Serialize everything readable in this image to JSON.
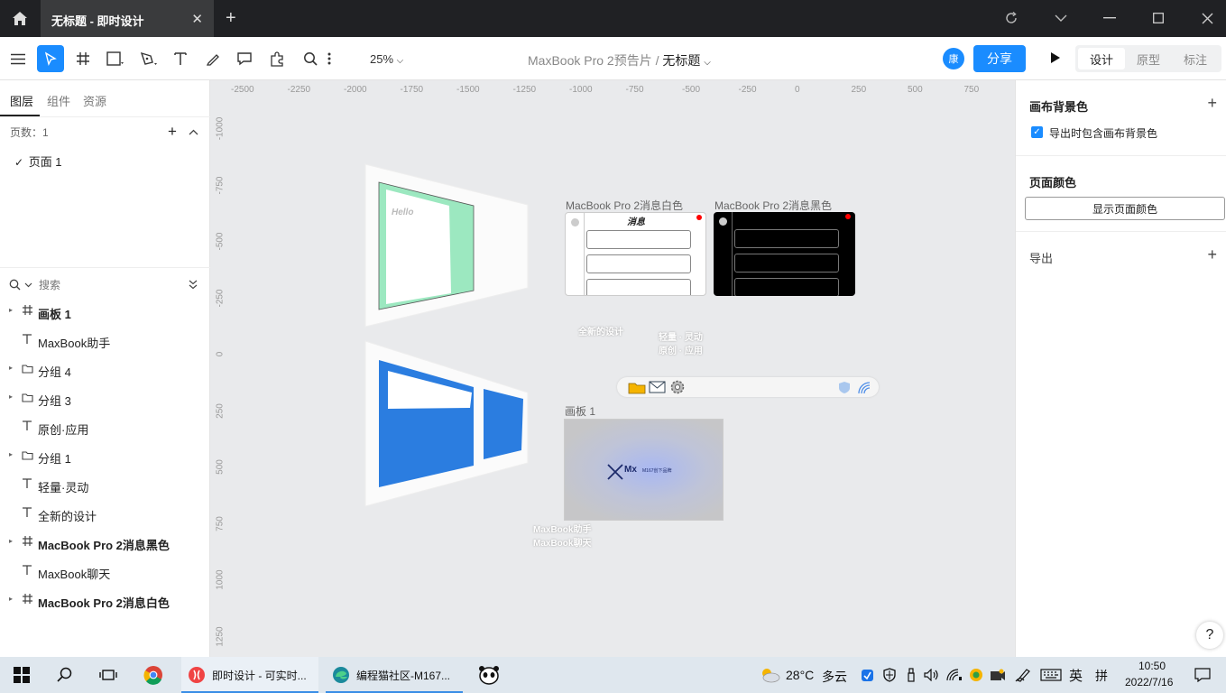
{
  "titlebar": {
    "tab_title": "无标题 - 即时设计",
    "close_glyph": "✕",
    "new_tab_glyph": "+"
  },
  "toolbar": {
    "zoom": "25%",
    "project": "MaxBook Pro 2预告片",
    "separator": "/",
    "file": "无标题",
    "avatar_initial": "康",
    "share_label": "分享",
    "modes": [
      "设计",
      "原型",
      "标注"
    ]
  },
  "left_panel": {
    "tabs": [
      "图层",
      "组件",
      "资源"
    ],
    "pages_label": "页数：1",
    "page_item": "页面 1",
    "search_placeholder": "搜索",
    "layers": [
      {
        "label": "画板 1",
        "type": "frame",
        "bold": true,
        "expandable": true
      },
      {
        "label": "MaxBook助手",
        "type": "text",
        "bold": false,
        "expandable": false
      },
      {
        "label": "分组 4",
        "type": "group",
        "bold": false,
        "expandable": true
      },
      {
        "label": "分组 3",
        "type": "group",
        "bold": false,
        "expandable": true
      },
      {
        "label": "原创·应用",
        "type": "text",
        "bold": false,
        "expandable": false
      },
      {
        "label": "分组 1",
        "type": "group",
        "bold": false,
        "expandable": true
      },
      {
        "label": "轻量·灵动",
        "type": "text",
        "bold": false,
        "expandable": false
      },
      {
        "label": "全新的设计",
        "type": "text",
        "bold": false,
        "expandable": false
      },
      {
        "label": "MacBook Pro 2消息黑色",
        "type": "frame",
        "bold": true,
        "expandable": true
      },
      {
        "label": "MaxBook聊天",
        "type": "text",
        "bold": false,
        "expandable": false
      },
      {
        "label": "MacBook Pro 2消息白色",
        "type": "frame",
        "bold": true,
        "expandable": true
      }
    ]
  },
  "canvas": {
    "ruler_top": [
      "-2500",
      "-2250",
      "-2000",
      "-1750",
      "-1500",
      "-1250",
      "-1000",
      "-750",
      "-500",
      "-250",
      "0",
      "250",
      "500",
      "750"
    ],
    "ruler_left": [
      "-1000",
      "-750",
      "-500",
      "-250",
      "0",
      "250",
      "500",
      "750",
      "1000",
      "1250"
    ],
    "frame_white_title": "MacBook Pro 2消息白色",
    "frame_white_header": "消息",
    "frame_black_title": "MacBook Pro 2消息黑色",
    "frame_board_title": "画板 1",
    "text_new_design": "全新的设计",
    "text_light_1": "轻量 · 灵动",
    "text_light_2": "原创 · 应用",
    "text_assistant": "MaxBook助手",
    "text_chat": "MaxBook聊天",
    "hello_text": "Hello",
    "board_logo_text": "Mx",
    "board_sub_text": "M167创下品牌",
    "colors": {
      "accent": "#1a8cff",
      "blue_card": "#2b7de0",
      "green_card": "#9ce8c0",
      "notify": "#ff0000"
    }
  },
  "right_panel": {
    "canvas_bg_title": "画布背景色",
    "export_bg_label": "导出时包含画布背景色",
    "page_color_title": "页面颜色",
    "show_page_color": "显示页面颜色",
    "export_title": "导出",
    "help_glyph": "?"
  },
  "taskbar": {
    "app1": "即时设计 - 可实时...",
    "app2": "编程猫社区-M167...",
    "weather_temp": "28°C",
    "weather_desc": "多云",
    "ime_lang": "英",
    "ime_mode": "拼",
    "time": "10:50",
    "date": "2022/7/16"
  }
}
